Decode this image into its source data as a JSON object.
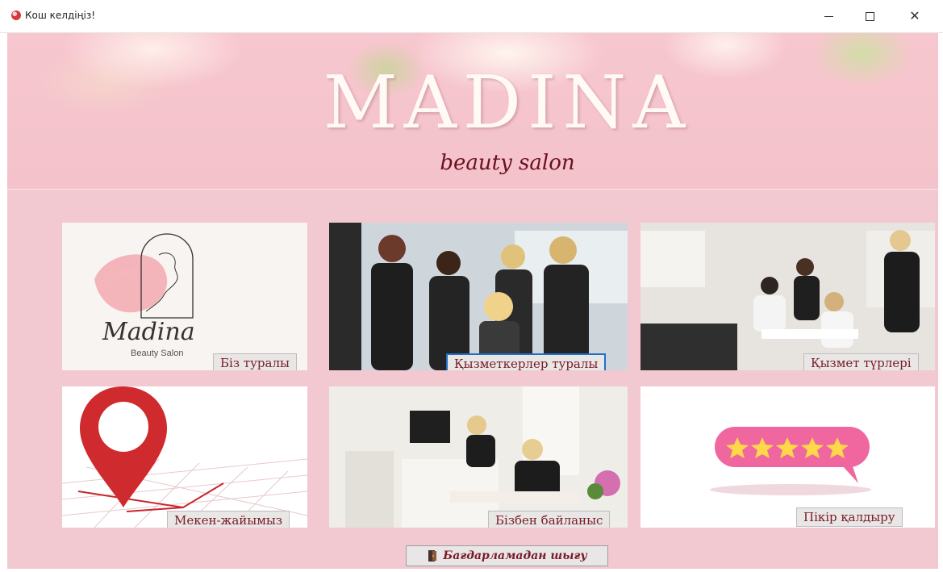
{
  "window": {
    "title": "Кош келдіңіз!",
    "icon": "app-icon"
  },
  "banner": {
    "brand": "MADINA",
    "tagline": "beauty salon"
  },
  "logo_tile": {
    "logo_script": "Madina",
    "logo_caption": "Beauty Salon"
  },
  "tiles": [
    {
      "label": "Біз туралы"
    },
    {
      "label": "Қызметкерлер туралы"
    },
    {
      "label": "Қызмет түрлері"
    },
    {
      "label": "Мекен-жайымыз"
    },
    {
      "label": "Бізбен байланыс"
    },
    {
      "label": "Пікір қалдыру"
    }
  ],
  "exit": {
    "label": "Бағдарламадан шығу",
    "icon": "exit-door-icon"
  },
  "colors": {
    "background_pink": "#f2c9d0",
    "label_text": "#7a1a26",
    "focus_border": "#1f6fc8"
  }
}
